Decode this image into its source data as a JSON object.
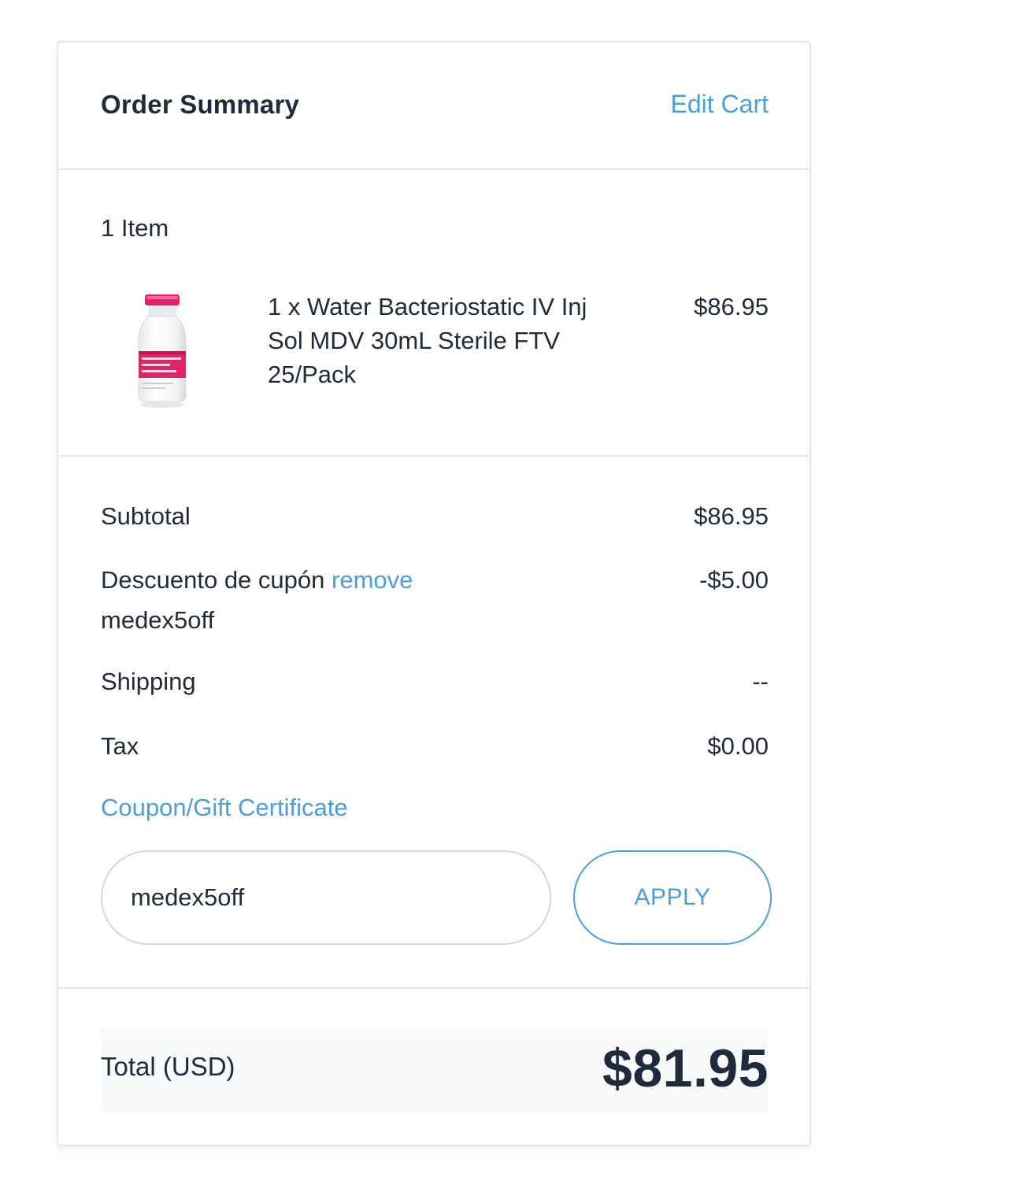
{
  "header": {
    "title": "Order Summary",
    "edit_cart_label": "Edit Cart"
  },
  "cart": {
    "item_count_label": "1 Item",
    "items": [
      {
        "name": "1 x Water Bacteriostatic IV Inj Sol MDV 30mL Sterile FTV 25/Pack",
        "price": "$86.95",
        "image_icon": "vial-bottle-icon"
      }
    ]
  },
  "totals": {
    "subtotal_label": "Subtotal",
    "subtotal_value": "$86.95",
    "discount_label": "Descuento de cupón",
    "discount_remove_label": "remove",
    "discount_code": "medex5off",
    "discount_value": "-$5.00",
    "shipping_label": "Shipping",
    "shipping_value": "--",
    "tax_label": "Tax",
    "tax_value": "$0.00"
  },
  "coupon": {
    "link_label": "Coupon/Gift Certificate",
    "input_value": "medex5off",
    "apply_label": "APPLY"
  },
  "grand_total": {
    "label": "Total (USD)",
    "value": "$81.95"
  },
  "colors": {
    "accent": "#4a9fd8",
    "text": "#1f2a3c",
    "border": "#e3e5e8",
    "vial_label": "#e0246c"
  }
}
